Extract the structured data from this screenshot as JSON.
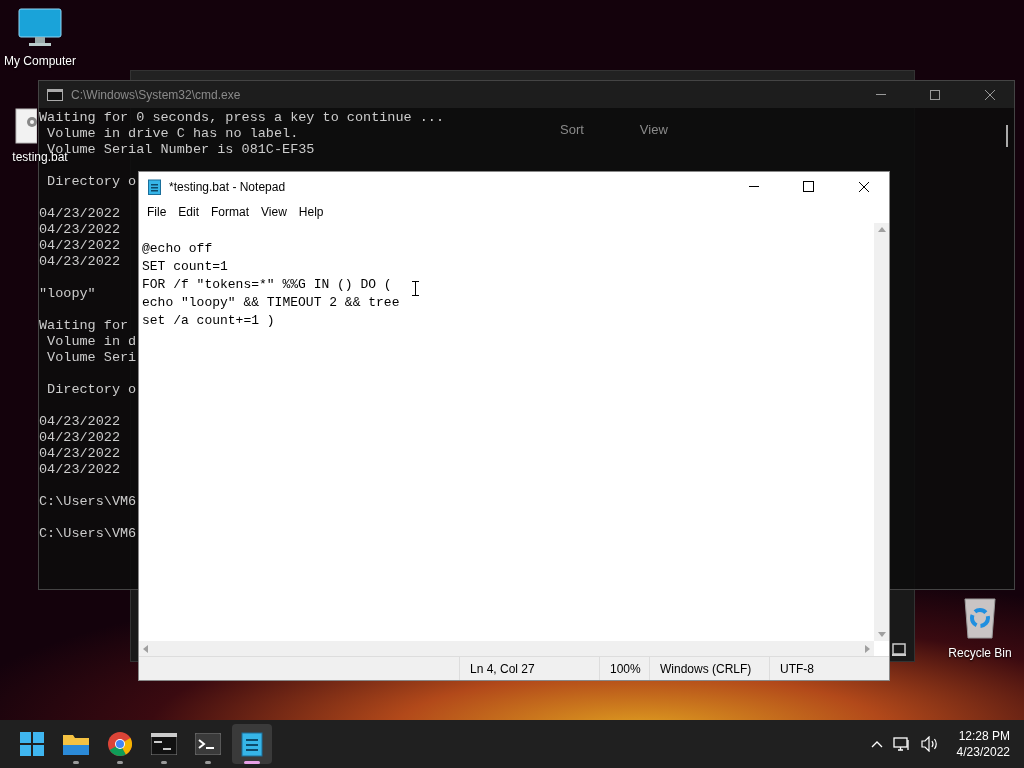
{
  "desktop_icons": [
    {
      "kind": "computer",
      "label": "My Computer"
    },
    {
      "kind": "batch",
      "label": "testing.bat"
    },
    {
      "kind": "recycle",
      "label": "Recycle Bin"
    }
  ],
  "explorer_window": {
    "toolbar": [
      {
        "label": "Sort"
      },
      {
        "label": "View"
      }
    ]
  },
  "cmd_window": {
    "title": "C:\\Windows\\System32\\cmd.exe",
    "blocks": [
      {
        "lines": [
          "Waiting for 0 seconds, press a key to continue ...",
          " Volume in drive C has no label.",
          " Volume Serial Number is 081C-EF35"
        ]
      },
      {
        "lines": [
          " Directory o"
        ]
      },
      {
        "lines": [
          "04/23/2022",
          "04/23/2022",
          "04/23/2022",
          "04/23/2022"
        ]
      },
      {
        "lines": [
          "\"loopy\""
        ]
      },
      {
        "lines": [
          "Waiting for",
          " Volume in d",
          " Volume Seri"
        ]
      },
      {
        "lines": [
          " Directory o"
        ]
      },
      {
        "lines": [
          "04/23/2022",
          "04/23/2022",
          "04/23/2022",
          "04/23/2022"
        ]
      },
      {
        "lines": [
          "C:\\Users\\VM6"
        ]
      },
      {
        "lines": [
          "C:\\Users\\VM6"
        ]
      }
    ]
  },
  "notepad": {
    "title": "*testing.bat - Notepad",
    "menu": [
      "File",
      "Edit",
      "Format",
      "View",
      "Help"
    ],
    "lines": [
      "@echo off",
      "SET count=1",
      "FOR /f \"tokens=*\" %%G IN () DO (",
      "echo \"loopy\" && TIMEOUT 2 && tree",
      "set /a count+=1 )"
    ],
    "status_bar": [
      "Ln 4, Col 27",
      "100%",
      "Windows (CRLF)",
      "UTF-8"
    ]
  },
  "taskbar": {
    "apps": [
      {
        "kind": "start",
        "selected": false
      },
      {
        "kind": "folder",
        "selected": false
      },
      {
        "kind": "browser",
        "selected": false
      },
      {
        "kind": "console",
        "selected": false
      },
      {
        "kind": "terminal",
        "selected": false
      },
      {
        "kind": "notepad",
        "selected": true
      }
    ],
    "time": "12:28 PM",
    "date": "4/23/2022"
  }
}
